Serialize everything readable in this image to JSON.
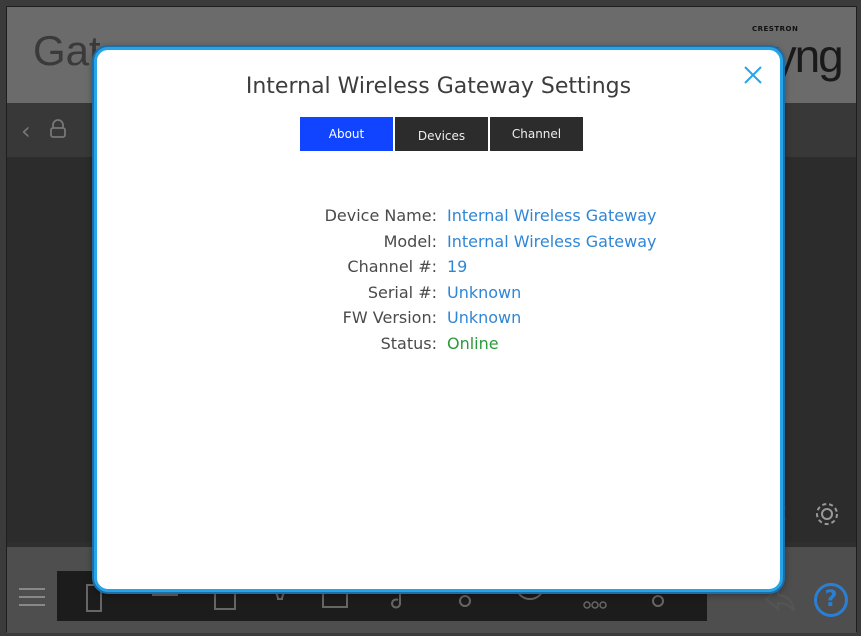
{
  "app": {
    "title": "Gat",
    "brand_small": "CRESTRON",
    "brand_big": "ayng"
  },
  "modal": {
    "title": "Internal Wireless Gateway Settings",
    "tabs": [
      {
        "label": "About",
        "active": true
      },
      {
        "label": "Devices",
        "active": false
      },
      {
        "label": "Channel",
        "active": false
      }
    ],
    "fields": [
      {
        "label": "Device Name:",
        "value": "Internal Wireless Gateway"
      },
      {
        "label": "Model:",
        "value": "Internal Wireless Gateway"
      },
      {
        "label": "Channel #:",
        "value": "19"
      },
      {
        "label": "Serial #:",
        "value": "Unknown"
      },
      {
        "label": "FW Version:",
        "value": "Unknown"
      },
      {
        "label": "Status:",
        "value": "Online"
      }
    ]
  },
  "help_label": "?",
  "colors": {
    "accent": "#29a3e8",
    "active_tab": "#1044ff",
    "value_blue": "#2f86d6",
    "status_online": "#2a9a3a"
  },
  "icons": [
    "close-icon",
    "back-chevron-icon",
    "lock-icon",
    "gear-icon",
    "menu-icon",
    "share-icon",
    "help-icon"
  ]
}
